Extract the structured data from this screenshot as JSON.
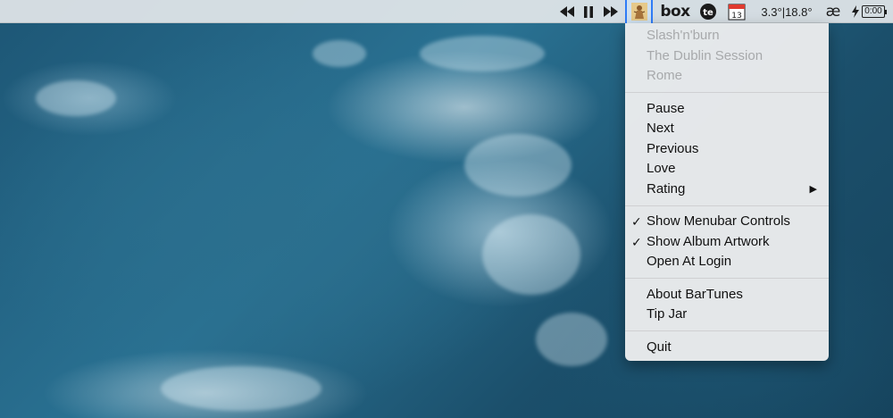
{
  "menubar": {
    "controls": {
      "previous_icon": "backward-icon",
      "pause_icon": "pause-icon",
      "next_icon": "forward-icon"
    },
    "bartunes_icon": "album-artwork-icon",
    "box_label": "box",
    "te_label": "te",
    "calendar_day": "13",
    "weather": "3.3°|18.8°",
    "ae_label": "æ",
    "battery_time": "0:00",
    "accent_color": "#2f7cf6"
  },
  "menu": {
    "now_playing": {
      "track": "Slash'n'burn",
      "album": "The Dublin Session",
      "artist": "Rome"
    },
    "playback": {
      "pause": "Pause",
      "next": "Next",
      "previous": "Previous",
      "love": "Love",
      "rating": "Rating"
    },
    "options": {
      "show_menubar_controls": "Show Menubar Controls",
      "show_album_artwork": "Show Album Artwork",
      "open_at_login": "Open At Login"
    },
    "about": "About BarTunes",
    "tip_jar": "Tip Jar",
    "quit": "Quit",
    "check_mark": "✓",
    "submenu_arrow": "▶"
  }
}
